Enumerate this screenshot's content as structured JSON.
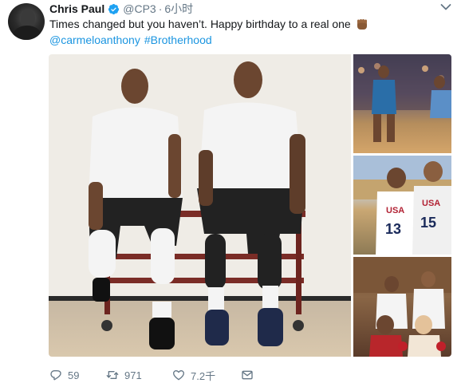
{
  "tweet": {
    "author_name": "Chris Paul",
    "handle": "@CP3",
    "separator": "·",
    "time": "6小时",
    "text": "Times changed but you haven’t. Happy birthday to a real one",
    "mention": "@carmeloanthony",
    "hashtag": "#Brotherhood"
  },
  "media": {
    "thumb2_jersey_left": "13",
    "thumb2_jersey_right": "15",
    "thumb2_team": "USA"
  },
  "actions": {
    "reply_count": "59",
    "retweet_count": "971",
    "like_count": "7.2千"
  },
  "colors": {
    "link": "#1b95e0",
    "muted": "#657786",
    "text": "#14171a",
    "verified": "#1da1f2"
  },
  "icons": [
    "verified-badge-icon",
    "fist-emoji-icon",
    "caret-down-icon",
    "reply-icon",
    "retweet-icon",
    "like-icon",
    "direct-message-icon"
  ]
}
